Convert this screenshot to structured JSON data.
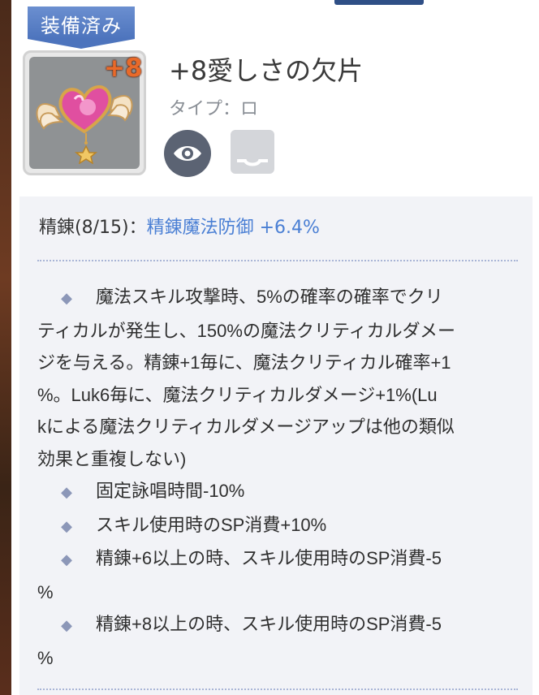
{
  "badge": {
    "label": "装備済み"
  },
  "item": {
    "level": "+8",
    "name": "+8愛しさの欠片",
    "type": "タイプ：ロ"
  },
  "refine": {
    "label": "精錬(8/15)：",
    "stat": "精錬魔法防御 +6.4%"
  },
  "effects": {
    "line1": "魔法スキル攻撃時、5%の確率の確率でクリ",
    "line2": "ティカルが発生し、150%の魔法クリティカルダメー",
    "line3": "ジを与える。精錬+1毎に、魔法クリティカル確率+1",
    "line4": "%。Luk6毎に、魔法クリティカルダメージ+1%(Lu",
    "line5": "kによる魔法クリティカルダメージアップは他の類似",
    "line6": "効果と重複しない)",
    "item2": "固定詠唱時間-10%",
    "item3": "スキル使用時のSP消費+10%",
    "item4a": "精錬+6以上の時、スキル使用時のSP消費-5",
    "item4b": "%",
    "item5a": "精錬+8以上の時、スキル使用時のSP消費-5",
    "item5b": "%"
  },
  "icons": {
    "bullet": "◆",
    "view": "eye-icon",
    "storage": "tray-icon"
  },
  "colors": {
    "accent_blue": "#4a7fd4",
    "badge_blue": "#5a80c6",
    "level_orange": "#e86a2a",
    "button_dark": "#5b6373"
  }
}
